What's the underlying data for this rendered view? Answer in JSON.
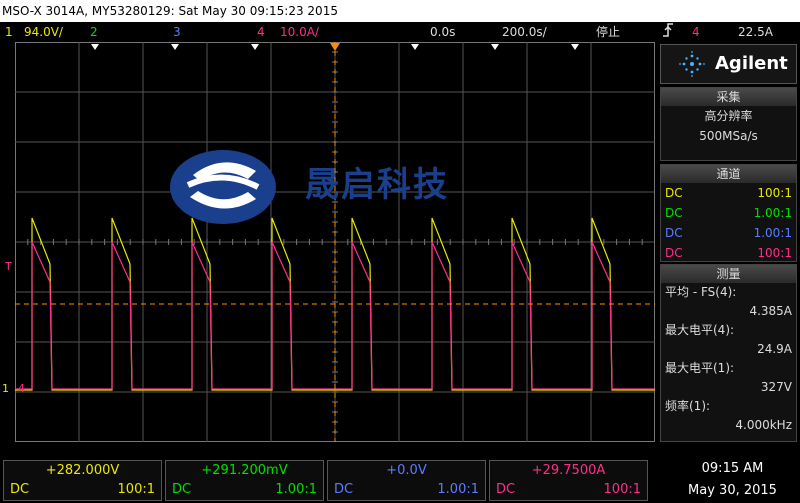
{
  "window": {
    "title": "MSO-X 3014A, MY53280129: Sat May 30 09:15:23 2015"
  },
  "top_bar": {
    "ch1": {
      "num": "1",
      "scale": "94.0V/"
    },
    "ch2": {
      "num": "2"
    },
    "ch3": {
      "num": "3"
    },
    "ch4": {
      "num": "4",
      "scale": "10.0A/"
    },
    "time_delay": "0.0s",
    "time_scale": "200.0s/",
    "run_state": "停止",
    "trigger_icon": "trigger-edge-icon",
    "trigger_source": "4",
    "trigger_level": "22.5A"
  },
  "brand": {
    "name": "Agilent",
    "watermark_text": "晟启科技"
  },
  "acquire": {
    "header": "采集",
    "mode": "高分辨率",
    "rate": "500MSa/s"
  },
  "channels": {
    "header": "通道",
    "rows": [
      {
        "coupling": "DC",
        "probe": "100:1",
        "color": "#e8e800"
      },
      {
        "coupling": "DC",
        "probe": "1.00:1",
        "color": "#00e000"
      },
      {
        "coupling": "DC",
        "probe": "1.00:1",
        "color": "#5a7dff"
      },
      {
        "coupling": "DC",
        "probe": "100:1",
        "color": "#ff2e8a"
      }
    ]
  },
  "measure": {
    "header": "测量",
    "items": [
      {
        "label": "平均 - FS(4):",
        "value": "4.385A"
      },
      {
        "label": "最大电平(4):",
        "value": "24.9A"
      },
      {
        "label": "最大电平(1):",
        "value": "327V"
      },
      {
        "label": "频率(1):",
        "value": "4.000kHz"
      }
    ]
  },
  "bottom": {
    "channels": [
      {
        "offset": "+282.000V",
        "coupling": "DC",
        "probe": "100:1",
        "color": "#e8e800"
      },
      {
        "offset": "+291.200mV",
        "coupling": "DC",
        "probe": "1.00:1",
        "color": "#00e000"
      },
      {
        "offset": "+0.0V",
        "coupling": "DC",
        "probe": "1.00:1",
        "color": "#5a7dff"
      },
      {
        "offset": "+29.7500A",
        "coupling": "DC",
        "probe": "100:1",
        "color": "#ff2e8a"
      }
    ],
    "time": "09:15 AM",
    "date": "May 30, 2015"
  },
  "screen": {
    "ground_marker": "1",
    "ch4_marker": "4",
    "trigger_marker": "T",
    "pulse_count": 8,
    "ch1_level_fraction": 0.43
  },
  "colors": {
    "ch1": "#e8e800",
    "ch2": "#00e000",
    "ch3": "#5a7dff",
    "ch4": "#ff2e8a",
    "trigger": "#ff8c00",
    "grid": "#555555"
  }
}
